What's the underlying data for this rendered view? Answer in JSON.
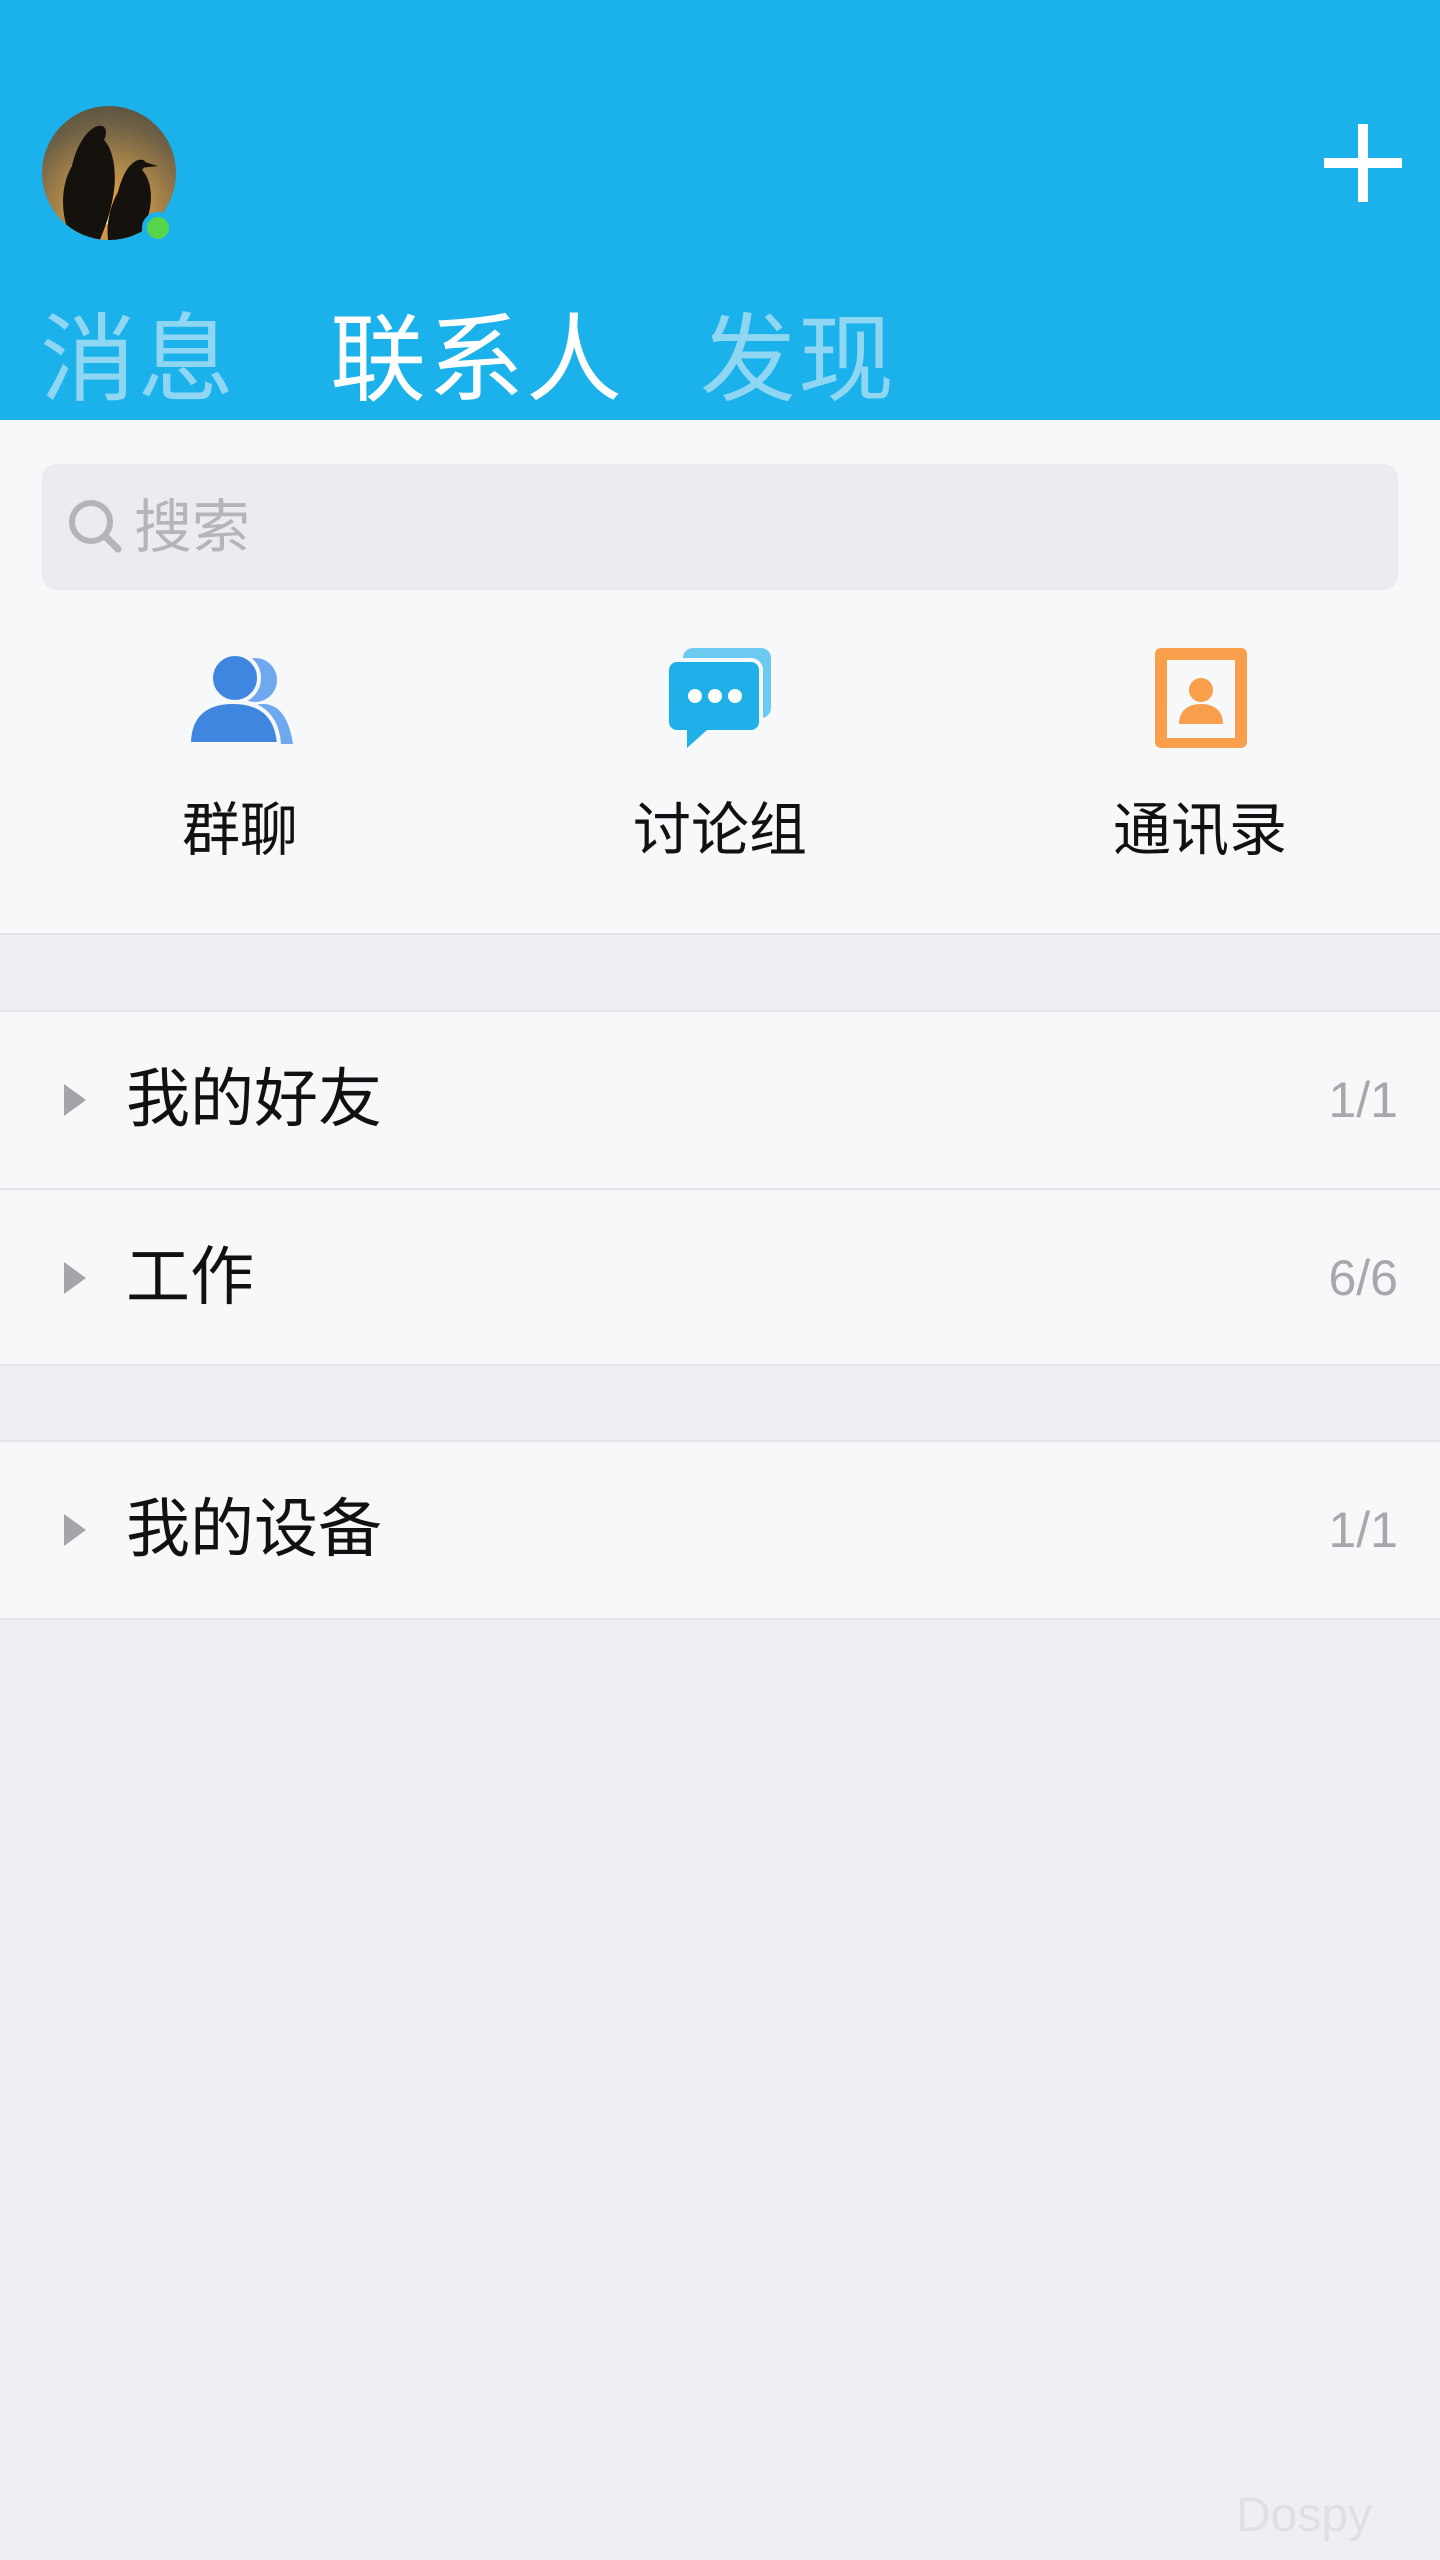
{
  "header": {
    "avatar_icon": "penguin-avatar-icon",
    "plus_icon": "plus-icon",
    "tabs": [
      {
        "label": "消息",
        "active": false
      },
      {
        "label": "联系人",
        "active": true
      },
      {
        "label": "发现",
        "active": false
      }
    ],
    "accent_color": "#1bb1eb"
  },
  "search": {
    "placeholder": "搜索",
    "icon": "search-icon"
  },
  "shortcuts": [
    {
      "label": "群聊",
      "icon": "group-chat-icon",
      "color": "#4a90e6"
    },
    {
      "label": "讨论组",
      "icon": "discussion-icon",
      "color": "#22b1eb"
    },
    {
      "label": "通讯录",
      "icon": "address-book-icon",
      "color": "#f99e4b"
    }
  ],
  "groups": [
    {
      "name": "我的好友",
      "count": "1/1"
    },
    {
      "name": "工作",
      "count": "6/6"
    }
  ],
  "devices": [
    {
      "name": "我的设备",
      "count": "1/1"
    }
  ],
  "watermark": "Dospy"
}
